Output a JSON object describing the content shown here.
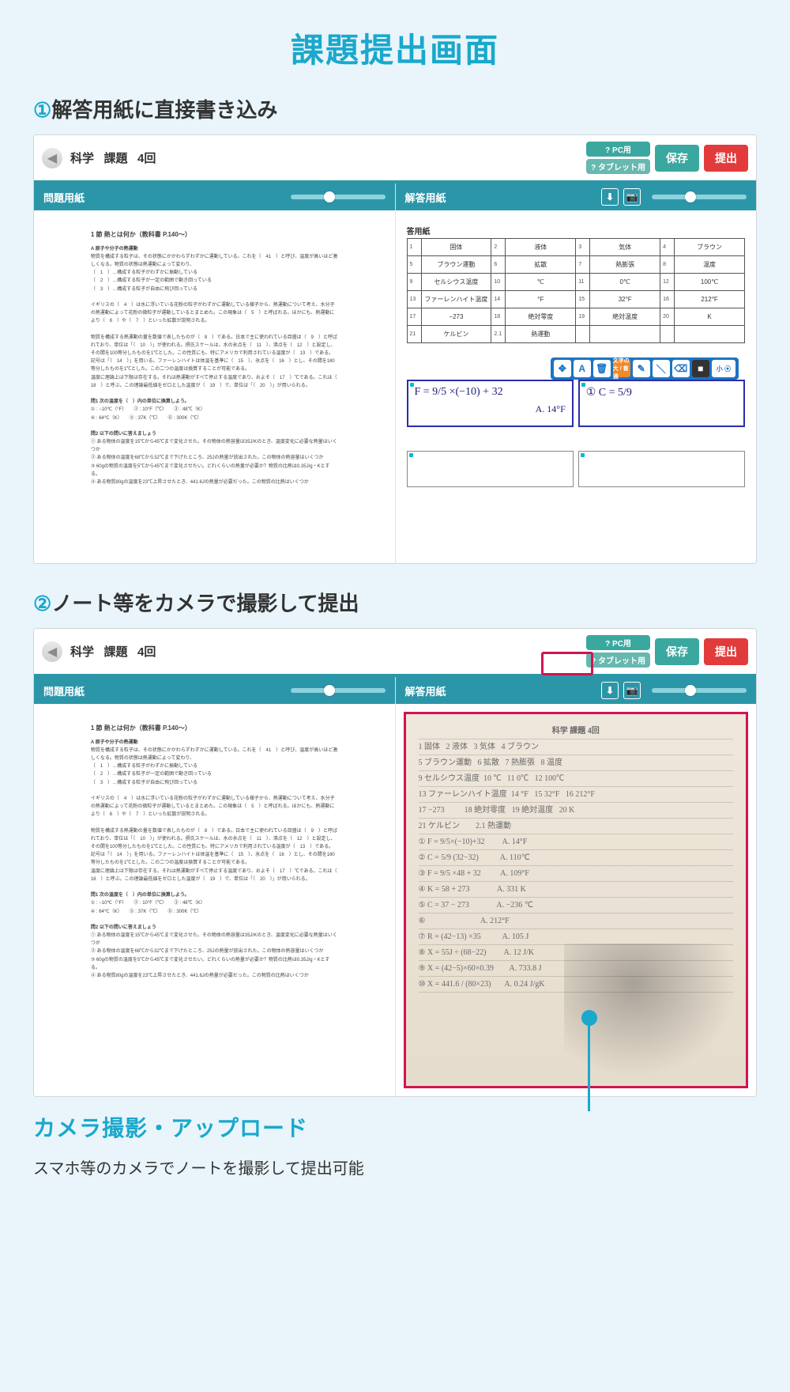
{
  "page": {
    "title": "課題提出画面",
    "step1_number": "①",
    "step1_text": "解答用紙に直接書き込み",
    "step2_number": "②",
    "step2_text": "ノート等をカメラで撮影して提出"
  },
  "app": {
    "breadcrumb": "科学   課題   4回",
    "buttons": {
      "pc": "? PC用",
      "tablet": "? タブレット用",
      "save": "保存",
      "submit": "提出"
    },
    "left_pane_title": "問題用紙",
    "right_pane_title": "解答用紙"
  },
  "doc": {
    "heading": "1 節 熱とは何か（教科書 P.140～）",
    "sub": "A 原子や分子の熱運動",
    "p1": "物質を構成する粒子は、その状態にかかわらずわずかに運動している。これを（　41　）と呼び、温度が高いほど激しくなる。物質の状態は熱運動によって変わり、",
    "l1": "（　1　）…構成する粒子がわずかに振動している",
    "l2": "（　2　）…構成する粒子が一定の範囲で動き回っている",
    "l3": "（　3　）…構成する粒子が自由に飛び回っている",
    "p2_top": "イギリスの（　4　）は水に浮いている花粉の粒子がわずかに運動している様子から、熱運動について考え、水分子の熱運動によって花粉の微粒子が運動しているとまとめた。この現象は（　5　）と呼ばれる。ほかにも、熱運動により（　6　）や（　7　）といった拡散が説明される。",
    "p2": "物質を構成する熱運動の量を数値で表したものが（　8　）である。日本で主に使われている目盛は（　9　）と呼ばれており、単位は「（　10　）」が使われる。摂氏スケールは、水の氷点を（　11　）、沸点を（　12　）と設定し、その間を100等分したものを1℃とした。この性質にも、特にアメリカで利用されている温度が（　13　）である。記号は「（　14　）」を用いる。ファーレンハイトは体温を基準に（　15　）、氷点を（　16　）とし、その間を180等分したものを1℃とした。この二つの温度は換算することが可能である。",
    "p3": "温度に理論上は下限は存在する。それは熱運動がすべて停止する温度であり、およそ（　17　）℃である。これは（　18　）と呼ぶ。この理論最低値をゼロとした温度が（　19　）で、単位は「（　20　）」が用いられる。",
    "q1_h": "問1 次の温度を（　）内の単位に換算しよう。",
    "q1_1": "① : −10℃（°F）　　② : 10°F（℃）　　③ : 48℃（K）",
    "q1_2": "④ : 64℃（K）　　⑤ : 37K（℃）　　⑥ : 300K（℃）",
    "q2_h": "問2 以下の問いに答えましょう",
    "q2_1": "① ある物体の温度を15℃から45℃まで変化させた。その物体の熱容量は35J/Kのとき、温度変化に必要な熱量はいくつか",
    "q2_2": "② ある物体の温度を68℃から32℃まで下げたところ、25Jの熱量が放出された。この物体の熱容量はいくつか",
    "q2_3": "③ 60gの物質の温度を5℃から45℃まで変化させたい。どれくらいの熱量が必要か？物質の比熱は0.35J/g・Kとする。",
    "q2_4": "④ ある物質80gの温度を23℃上昇させたとき、441.6Jの熱量が必要だった。この物質の比熱はいくつか"
  },
  "answer_table": {
    "caption": "答用紙",
    "rows": [
      [
        {
          "n": "1",
          "v": "固体"
        },
        {
          "n": "2",
          "v": "液体"
        },
        {
          "n": "3",
          "v": "気体"
        },
        {
          "n": "4",
          "v": "ブラウン"
        }
      ],
      [
        {
          "n": "5",
          "v": "ブラウン運動"
        },
        {
          "n": "6",
          "v": "拡散"
        },
        {
          "n": "7",
          "v": "熱膨張"
        },
        {
          "n": "8",
          "v": "温度"
        }
      ],
      [
        {
          "n": "9",
          "v": "セルシウス温度"
        },
        {
          "n": "10",
          "v": "℃"
        },
        {
          "n": "11",
          "v": "0℃"
        },
        {
          "n": "12",
          "v": "100℃"
        }
      ],
      [
        {
          "n": "13",
          "v": "ファーレンハイト温度"
        },
        {
          "n": "14",
          "v": "°F"
        },
        {
          "n": "15",
          "v": "32°F"
        },
        {
          "n": "16",
          "v": "212°F"
        }
      ],
      [
        {
          "n": "17",
          "v": "−273"
        },
        {
          "n": "18",
          "v": "絶対零度"
        },
        {
          "n": "19",
          "v": "絶対温度"
        },
        {
          "n": "20",
          "v": "K"
        }
      ],
      [
        {
          "n": "21",
          "v": "ケルビン"
        },
        {
          "n": "2.1",
          "v": "熱運動"
        },
        {
          "n": "",
          "v": ""
        },
        {
          "n": "",
          "v": ""
        }
      ]
    ],
    "handwriting": {
      "cell1_line": "F = 9/5 ×(−10) + 32",
      "cell1_ans": "A. 14°F",
      "cell2_line": "① C = 5/9"
    }
  },
  "toolbar": {
    "move": "✥",
    "text": "A",
    "trash": "🗑",
    "size": "文字の大 / 普通",
    "pen": "✎",
    "line": "＼",
    "erase": "⌫",
    "color": "■",
    "small": "小 ⦿"
  },
  "notebook": {
    "title": "科学 課題 4回",
    "lines": [
      "1 固体   2 液体   3 気体   4 ブラウン",
      "5 ブラウン運動   6 拡散   7 熱膨張   8 温度",
      "9 セルシウス温度  10 ℃   11 0℃   12 100℃",
      "13 ファーレンハイト温度  14 °F   15 32°F   16 212°F",
      "17 −273          18 絶対零度   19 絶対温度   20 K",
      "21 ケルビン        2.1 熱運動",
      "① F = 9/5×(−10)+32         A. 14°F",
      "② C = 5/9 (32−32)           A. 110℃",
      "③ F = 9/5 ×48 + 32          A. 109°F",
      "④ K = 58 + 273              A. 331 K",
      "⑤ C = 37 − 273              A. −236 ℃",
      "⑥                            A. 212°F",
      "⑦ R = (42−13) ×35           A. 105 J",
      "⑧ X = 55J ÷ (68−22)         A. 12 J/K",
      "⑨ X = (42−5)×60×0.39        A. 733.8 J",
      "⑩ X = 441.6 / (80×23)       A. 0.24 J/gK"
    ]
  },
  "callout": {
    "title": "カメラ撮影・アップロード",
    "desc": "スマホ等のカメラでノートを撮影して提出可能"
  }
}
